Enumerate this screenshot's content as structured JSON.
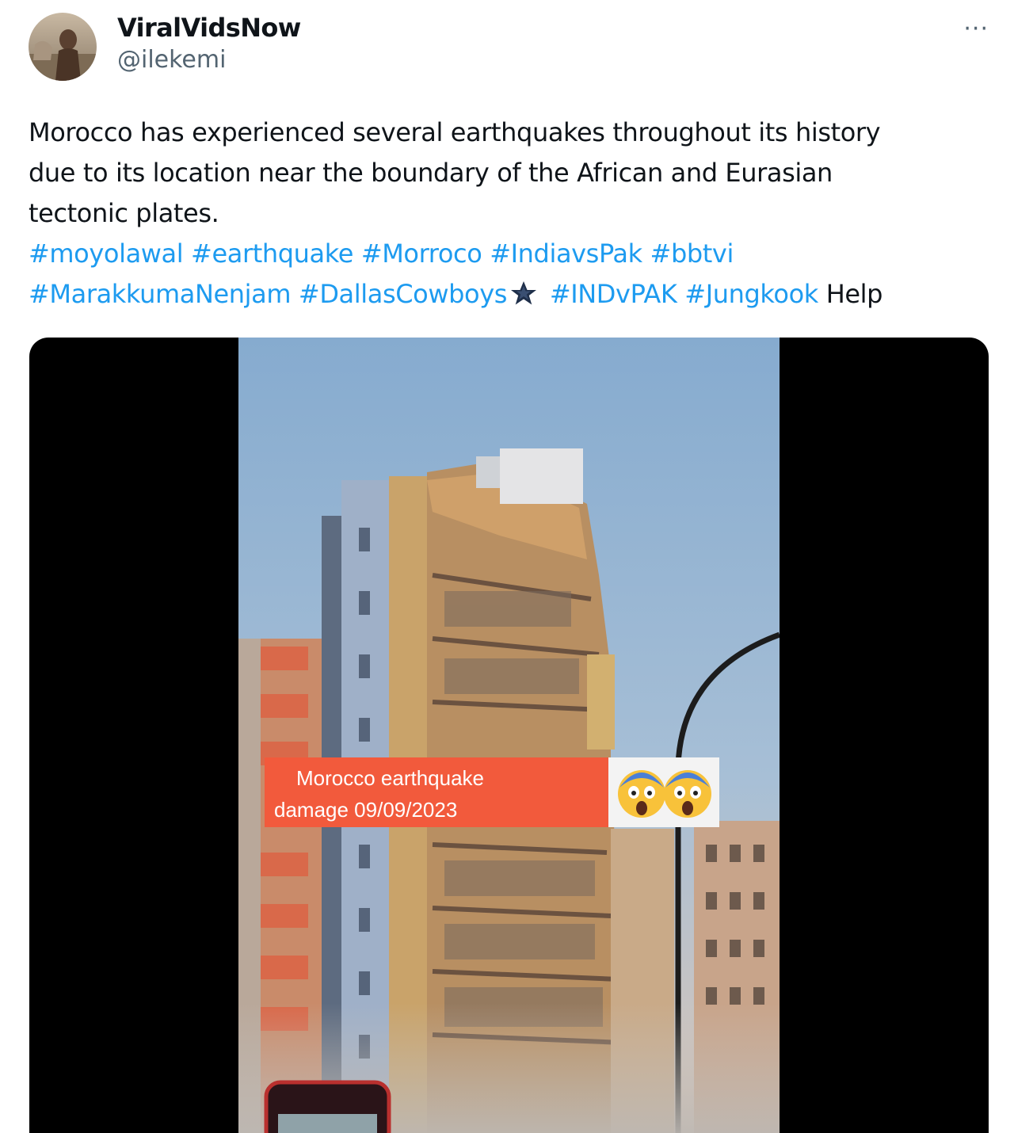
{
  "author": {
    "display_name": "ViralVidsNow",
    "handle": "@ilekemi",
    "avatar_icon": "profile-photo"
  },
  "more_menu": {
    "label": "···",
    "icon": "more-options-icon"
  },
  "post": {
    "text_lines": [
      "Morocco has experienced several earthquakes throughout its history",
      "due to its location near the boundary of the African and Eurasian",
      "tectonic plates."
    ],
    "hashtags_line1": [
      "#moyolawal",
      "#earthquake",
      "#Morroco",
      "#IndiavsPak",
      "#bbtvi"
    ],
    "hashtags_line2_a": [
      "#MarakkumaNenjam",
      "#DallasCowboys"
    ],
    "emoji_icon": "star-icon",
    "hashtags_line2_b": [
      "#INDvPAK",
      "#Jungkook"
    ],
    "trailing_word": "Help",
    "link_color": "#1d9bf0"
  },
  "media": {
    "type": "video",
    "caption_line1": "Morocco earthquake",
    "caption_line2": "damage 09/09/2023",
    "emoji_icons": [
      "screaming-face-icon",
      "screaming-face-icon"
    ],
    "caption_color": "#f25a3c"
  }
}
